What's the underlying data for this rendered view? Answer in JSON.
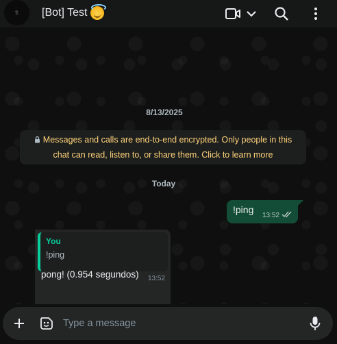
{
  "header": {
    "title": "[Bot] Test",
    "icons": [
      "avatar",
      "video-call-icon",
      "chevron-down-icon",
      "search-icon",
      "menu-icon"
    ]
  },
  "chat": {
    "date_label": "8/13/2025",
    "encryption_notice_line1": "Messages and calls are end-to-end encrypted. Only people in this",
    "encryption_notice_line2": "chat can read, listen to, or share them. Click to learn more",
    "today_label": "Today",
    "messages": [
      {
        "direction": "outgoing",
        "text": "!ping",
        "time": "13:52",
        "status": "read"
      },
      {
        "direction": "incoming",
        "quoted_author": "You",
        "quoted_text": "!ping",
        "text": "pong! (0.954 segundos)",
        "time": "13:52"
      }
    ]
  },
  "composer": {
    "placeholder": "Type a message",
    "icons": [
      "plus-icon",
      "sticker-icon",
      "mic-icon"
    ]
  },
  "colors": {
    "accent": "#06cf9c",
    "outgoing_bubble": "#144d37",
    "incoming_bubble": "#242626",
    "notice_text": "#ffd279"
  }
}
